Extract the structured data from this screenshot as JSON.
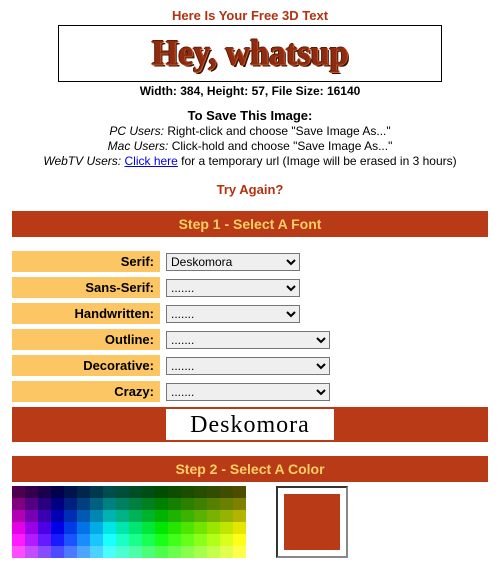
{
  "header": {
    "title": "Here Is Your Free 3D Text",
    "rendered_text": "Hey, whatsup",
    "dimensions": "Width: 384, Height: 57, File Size: 16140"
  },
  "save": {
    "title": "To Save This Image:",
    "pc_label": "PC Users:",
    "pc_text": " Right-click and choose \"Save Image As...\"",
    "mac_label": "Mac Users:",
    "mac_text": " Click-hold and choose \"Save Image As...\"",
    "webtv_label": "WebTV Users:",
    "webtv_link": "Click here",
    "webtv_text": " for a temporary url (Image will be erased in 3 hours)"
  },
  "try_again": "Try Again?",
  "step1": {
    "title": "Step 1 - Select A Font",
    "rows": {
      "serif": {
        "label": "Serif:",
        "value": "Deskomora",
        "width": "narrow"
      },
      "sans_serif": {
        "label": "Sans-Serif:",
        "value": ".......",
        "width": "narrow"
      },
      "handwritten": {
        "label": "Handwritten:",
        "value": ".......",
        "width": "narrow"
      },
      "outline": {
        "label": "Outline:",
        "value": ".......",
        "width": "wide"
      },
      "decorative": {
        "label": "Decorative:",
        "value": ".......",
        "width": "wide"
      },
      "crazy": {
        "label": "Crazy:",
        "value": ".......",
        "width": "wide"
      }
    },
    "preview": "Deskomora"
  },
  "step2": {
    "title": "Step 2 - Select A Color",
    "selected_color": "#b83a16"
  },
  "palette": {
    "rows": 6,
    "cols": 18,
    "hues": [
      300,
      280,
      260,
      240,
      225,
      210,
      195,
      180,
      165,
      150,
      135,
      120,
      110,
      100,
      90,
      80,
      70,
      60
    ],
    "lightness": [
      15,
      25,
      35,
      45,
      55,
      65
    ]
  }
}
